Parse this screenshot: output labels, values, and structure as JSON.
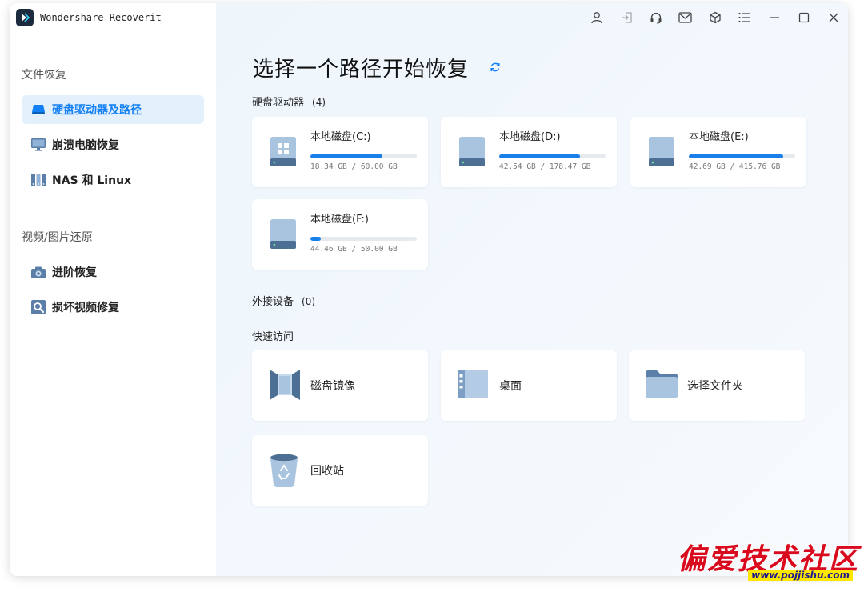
{
  "app": {
    "title": "Wondershare Recoverit"
  },
  "sidebar": {
    "sections": [
      {
        "title": "文件恢复",
        "items": [
          {
            "label": "硬盘驱动器及路径",
            "icon": "hard-drive-icon",
            "active": true
          },
          {
            "label": "崩溃电脑恢复",
            "icon": "monitor-icon",
            "active": false
          },
          {
            "label": "NAS 和 Linux",
            "icon": "nas-icon",
            "active": false
          }
        ]
      },
      {
        "title": "视频/图片还原",
        "items": [
          {
            "label": "进阶恢复",
            "icon": "camera-icon",
            "active": false
          },
          {
            "label": "损坏视频修复",
            "icon": "video-repair-icon",
            "active": false
          }
        ]
      }
    ]
  },
  "topbar": {
    "icons": [
      "user-icon",
      "sign-in-icon",
      "headset-icon",
      "mail-icon",
      "cube-icon",
      "menu-icon",
      "minimize-icon",
      "maximize-icon",
      "close-icon"
    ]
  },
  "main": {
    "title": "选择一个路径开始恢复",
    "drives_header": {
      "label": "硬盘驱动器",
      "count": "(4)"
    },
    "drives": [
      {
        "name": "本地磁盘(C:)",
        "size": "18.34 GB / 60.00 GB",
        "used_fraction": 0.68,
        "icon": "windows-drive-icon"
      },
      {
        "name": "本地磁盘(D:)",
        "size": "42.54 GB / 178.47 GB",
        "used_fraction": 0.76,
        "icon": "drive-icon"
      },
      {
        "name": "本地磁盘(E:)",
        "size": "42.69 GB / 415.76 GB",
        "used_fraction": 0.89,
        "icon": "drive-icon"
      },
      {
        "name": "本地磁盘(F:)",
        "size": "44.46 GB / 50.00 GB",
        "used_fraction": 0.1,
        "icon": "drive-icon"
      }
    ],
    "external_header": {
      "label": "外接设备",
      "count": "(0)"
    },
    "quick_header": {
      "label": "快速访问"
    },
    "quick_access": [
      {
        "label": "磁盘镜像",
        "icon": "disk-image-icon"
      },
      {
        "label": "桌面",
        "icon": "desktop-icon"
      },
      {
        "label": "选择文件夹",
        "icon": "folder-icon"
      },
      {
        "label": "回收站",
        "icon": "recycle-bin-icon"
      }
    ]
  },
  "watermark": {
    "text": "偏爱技术社区",
    "url": "www.pojjishu.com"
  },
  "colors": {
    "accent": "#1480f5",
    "active_bg": "#e4f1fd",
    "bar_fill": "#1a7fe8"
  }
}
